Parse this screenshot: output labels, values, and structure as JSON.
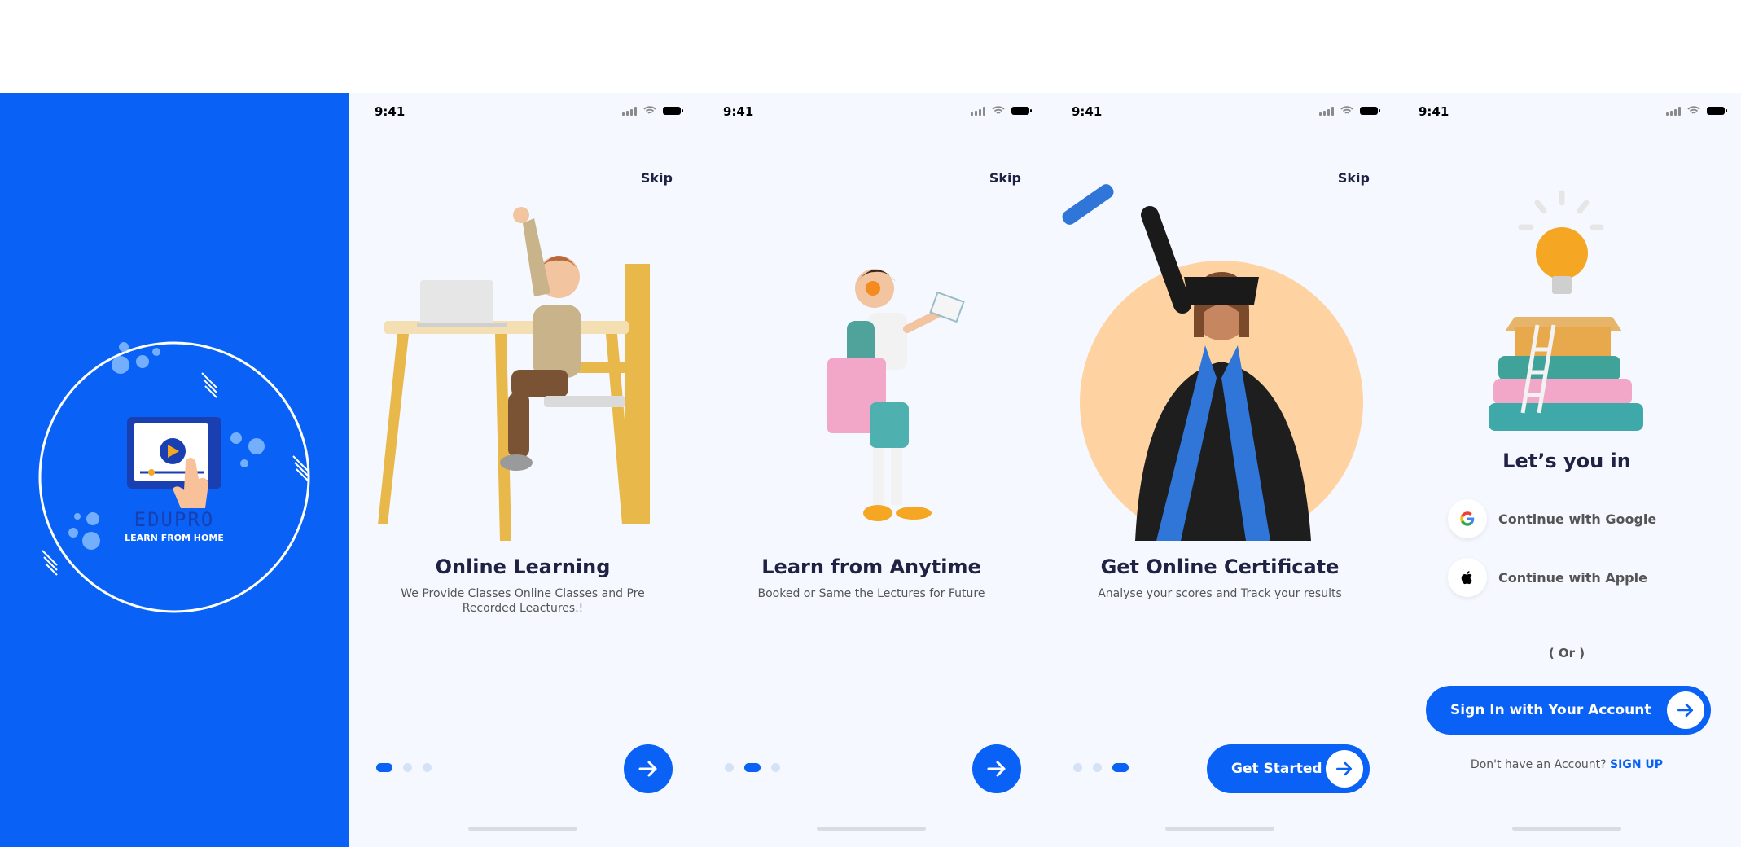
{
  "splash": {
    "brand": "EDUPRO",
    "tagline": "LEARN FROM HOME",
    "logo_icon": "play-video-tap-icon",
    "background_color": "#0961F5"
  },
  "status_bar": {
    "time": "9:41"
  },
  "onboarding": [
    {
      "skip": "Skip",
      "title": "Online Learning",
      "description": "We Provide Classes Online Classes and Pre Recorded Leactures.!",
      "active_step": 1,
      "illustration": "boy-with-laptop-at-desk"
    },
    {
      "skip": "Skip",
      "title": "Learn from Anytime",
      "description": "Booked or Same the Lectures for Future",
      "active_step": 2,
      "illustration": "boy-walking-with-book"
    },
    {
      "skip": "Skip",
      "title": "Get Online Certificate",
      "description": "Analyse your scores and Track your results",
      "active_step": 3,
      "illustration": "graduate-with-diploma",
      "cta": "Get Started"
    }
  ],
  "login": {
    "illustration": "lightbulb-books-ladder",
    "heading": "Let’s you in",
    "google": "Continue with Google",
    "apple": "Continue with Apple",
    "or": "( Or )",
    "signin": "Sign In with Your Account",
    "no_account": "Don't have an Account?",
    "signup": "SIGN UP"
  },
  "colors": {
    "primary": "#0961F5",
    "background": "#F5F9FF",
    "text": "#202244",
    "muted": "#545454"
  }
}
